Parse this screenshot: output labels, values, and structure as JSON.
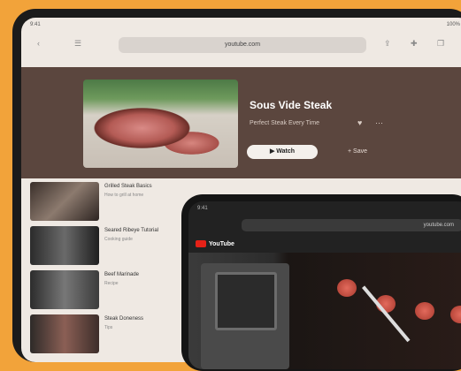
{
  "tablet": {
    "status": {
      "time": "9:41",
      "battery": "100%"
    },
    "url": "youtube.com",
    "hero": {
      "title": "Sous Vide Steak",
      "subtitle": "Perfect Steak Every Time",
      "watch_label": "▶ Watch",
      "later_label": "+ Save"
    },
    "list": [
      {
        "title": "Grilled Steak Basics",
        "meta": "How to grill at home"
      },
      {
        "title": "Seared Ribeye Tutorial",
        "meta": "Cooking guide"
      },
      {
        "title": "Beef Marinade",
        "meta": "Recipe"
      },
      {
        "title": "Steak Doneness",
        "meta": "Tips"
      }
    ]
  },
  "phone": {
    "status": "9:41",
    "url": "youtube.com",
    "logo": "YouTube"
  },
  "colors": {
    "background": "#f2a33a",
    "hero": "#5b463e",
    "brand_red": "#e62117"
  },
  "icons": [
    "back-icon",
    "bookmark-icon",
    "share-icon",
    "tabs-icon",
    "like-icon",
    "more-icon"
  ]
}
